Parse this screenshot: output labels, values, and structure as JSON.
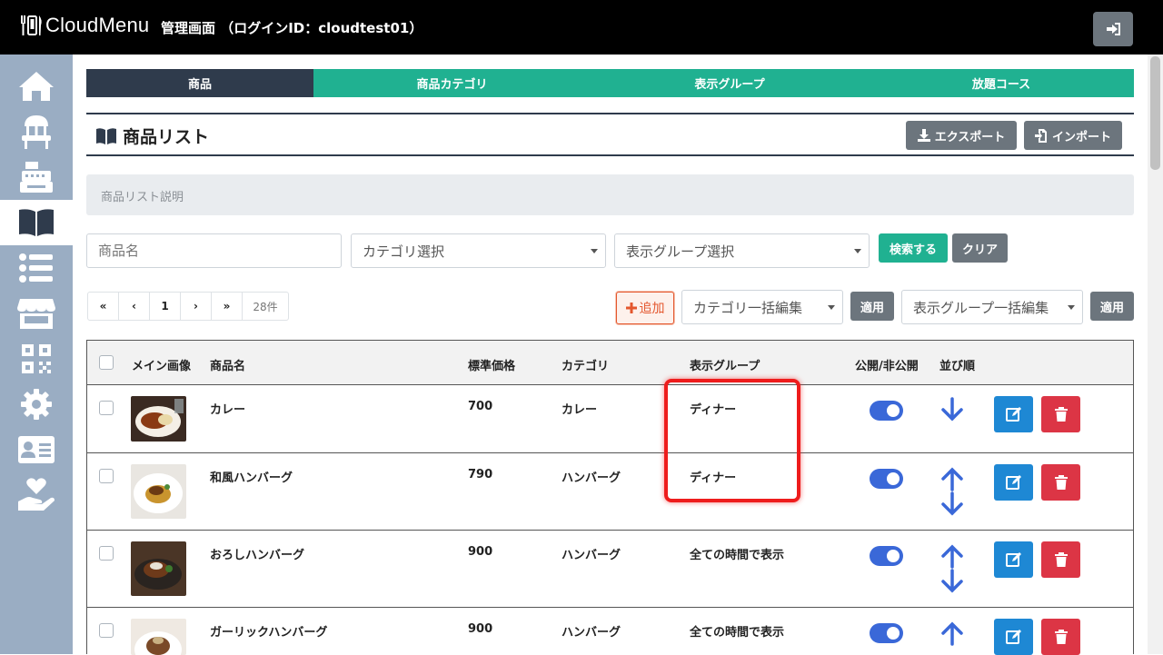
{
  "header": {
    "brand": "CloudMenu",
    "admin_title": "管理画面 （ログインID：cloudtest01）"
  },
  "sidebar": {
    "items": [
      {
        "icon": "home-icon"
      },
      {
        "icon": "chair-icon"
      },
      {
        "icon": "cash-register-icon"
      },
      {
        "icon": "book-open-icon",
        "active": true
      },
      {
        "icon": "list-icon"
      },
      {
        "icon": "store-icon"
      },
      {
        "icon": "qrcode-icon"
      },
      {
        "icon": "gear-icon"
      },
      {
        "icon": "id-card-icon"
      },
      {
        "icon": "hand-heart-icon"
      }
    ]
  },
  "tabs": [
    {
      "label": "商品",
      "active": true
    },
    {
      "label": "商品カテゴリ"
    },
    {
      "label": "表示グループ"
    },
    {
      "label": "放題コース"
    }
  ],
  "section": {
    "title": "商品リスト",
    "export_label": "エクスポート",
    "import_label": "インポート",
    "description": "商品リスト説明"
  },
  "filters": {
    "name_placeholder": "商品名",
    "category_select": "カテゴリ選択",
    "group_select": "表示グループ選択",
    "search_label": "検索する",
    "clear_label": "クリア"
  },
  "pagination": {
    "first": "«",
    "prev": "‹",
    "page": "1",
    "next": "›",
    "last": "»",
    "count": "28件"
  },
  "bulk": {
    "add_label": "追加",
    "category_bulk": "カテゴリ一括編集",
    "apply1": "適用",
    "group_bulk": "表示グループ一括編集",
    "apply2": "適用"
  },
  "table": {
    "headers": {
      "image": "メイン画像",
      "name": "商品名",
      "price": "標準価格",
      "category": "カテゴリ",
      "group": "表示グループ",
      "publish": "公開/非公開",
      "order": "並び順"
    },
    "rows": [
      {
        "name": "カレー",
        "price": "700",
        "category": "カレー",
        "group": "ディナー",
        "published": true
      },
      {
        "name": "和風ハンバーグ",
        "price": "790",
        "category": "ハンバーグ",
        "group": "ディナー",
        "published": true
      },
      {
        "name": "おろしハンバーグ",
        "price": "900",
        "category": "ハンバーグ",
        "group": "全ての時間で表示",
        "published": true
      },
      {
        "name": "ガーリックハンバーグ",
        "price": "900",
        "category": "ハンバーグ",
        "group": "全ての時間で表示",
        "published": true
      }
    ]
  },
  "colors": {
    "topbar": "#000000",
    "sidebar": "#9aadc3",
    "tab_active": "#2f3b4c",
    "tab": "#20b191",
    "edit": "#1e88d4",
    "delete": "#dc3545",
    "toggle": "#3a68d8",
    "highlight": "#ee1c1c"
  }
}
